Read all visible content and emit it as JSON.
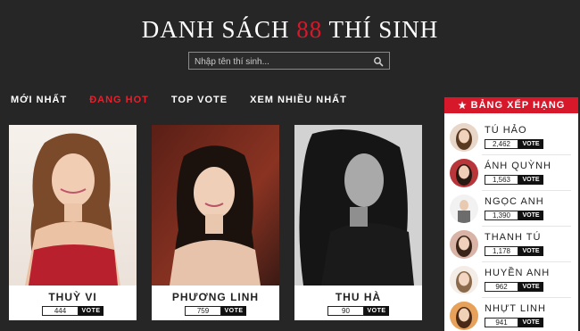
{
  "header": {
    "title_part1": "DANH SÁCH ",
    "title_number": "88",
    "title_part2": " THÍ SINH"
  },
  "search": {
    "placeholder": "Nhập tên thí sinh...",
    "value": "",
    "icon": "search-icon"
  },
  "tabs": [
    {
      "label": "MỚI NHẤT",
      "active": false
    },
    {
      "label": "ĐANG HOT",
      "active": true
    },
    {
      "label": "TOP VOTE",
      "active": false
    },
    {
      "label": "XEM NHIỀU NHẤT",
      "active": false
    }
  ],
  "contestants": [
    {
      "name": "THUỲ VI",
      "votes": "444",
      "vote_label": "VOTE"
    },
    {
      "name": "PHƯƠNG LINH",
      "votes": "759",
      "vote_label": "VOTE"
    },
    {
      "name": "THU HÀ",
      "votes": "90",
      "vote_label": "VOTE"
    }
  ],
  "ranking": {
    "title": "BẢNG XẾP HẠNG",
    "icon": "star-icon",
    "items": [
      {
        "name": "TÚ HẢO",
        "votes": "2,462",
        "vote_label": "VOTE"
      },
      {
        "name": "ÁNH QUỲNH",
        "votes": "1,563",
        "vote_label": "VOTE"
      },
      {
        "name": "NGỌC ANH",
        "votes": "1,390",
        "vote_label": "VOTE"
      },
      {
        "name": "THANH TÚ",
        "votes": "1,178",
        "vote_label": "VOTE"
      },
      {
        "name": "HUYỀN ANH",
        "votes": "962",
        "vote_label": "VOTE"
      },
      {
        "name": "NHỰT LINH",
        "votes": "941",
        "vote_label": "VOTE"
      }
    ]
  },
  "colors": {
    "background": "#262626",
    "accent": "#d7182a",
    "active_tab": "#e2222f"
  }
}
